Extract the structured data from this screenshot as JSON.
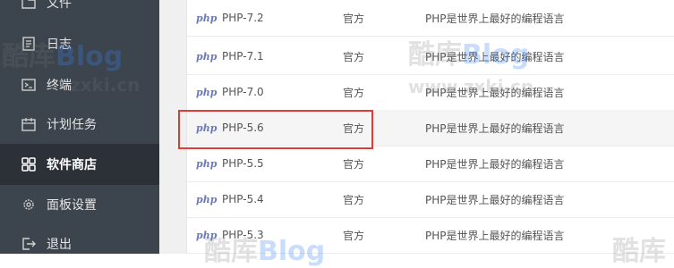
{
  "sidebar": {
    "items": [
      {
        "label": "文件",
        "icon": "folder-icon"
      },
      {
        "label": "日志",
        "icon": "log-icon"
      },
      {
        "label": "终端",
        "icon": "terminal-icon"
      },
      {
        "label": "计划任务",
        "icon": "calendar-icon"
      },
      {
        "label": "软件商店",
        "icon": "grid-icon",
        "active": true
      },
      {
        "label": "面板设置",
        "icon": "gear-icon"
      },
      {
        "label": "退出",
        "icon": "logout-icon"
      }
    ]
  },
  "software_list": {
    "rows": [
      {
        "logo": "php",
        "name": "PHP-7.2",
        "type": "官方",
        "desc": "PHP是世界上最好的编程语言"
      },
      {
        "logo": "php",
        "name": "PHP-7.1",
        "type": "官方",
        "desc": "PHP是世界上最好的编程语言"
      },
      {
        "logo": "php",
        "name": "PHP-7.0",
        "type": "官方",
        "desc": "PHP是世界上最好的编程语言"
      },
      {
        "logo": "php",
        "name": "PHP-5.6",
        "type": "官方",
        "desc": "PHP是世界上最好的编程语言",
        "highlighted": true
      },
      {
        "logo": "php",
        "name": "PHP-5.5",
        "type": "官方",
        "desc": "PHP是世界上最好的编程语言"
      },
      {
        "logo": "php",
        "name": "PHP-5.4",
        "type": "官方",
        "desc": "PHP是世界上最好的编程语言"
      },
      {
        "logo": "php",
        "name": "PHP-5.3",
        "type": "官方",
        "desc": "PHP是世界上最好的编程语言"
      }
    ]
  },
  "watermarks": {
    "brand_cn": "酷库",
    "brand_en": "Blog",
    "url": "www.zxki.cn",
    "url_partial": "zxki.cn"
  },
  "colors": {
    "sidebar_bg": "#3c444d",
    "sidebar_active_bg": "#2c3138",
    "highlight_border": "#e53935",
    "php_logo": "#6b79b5"
  }
}
